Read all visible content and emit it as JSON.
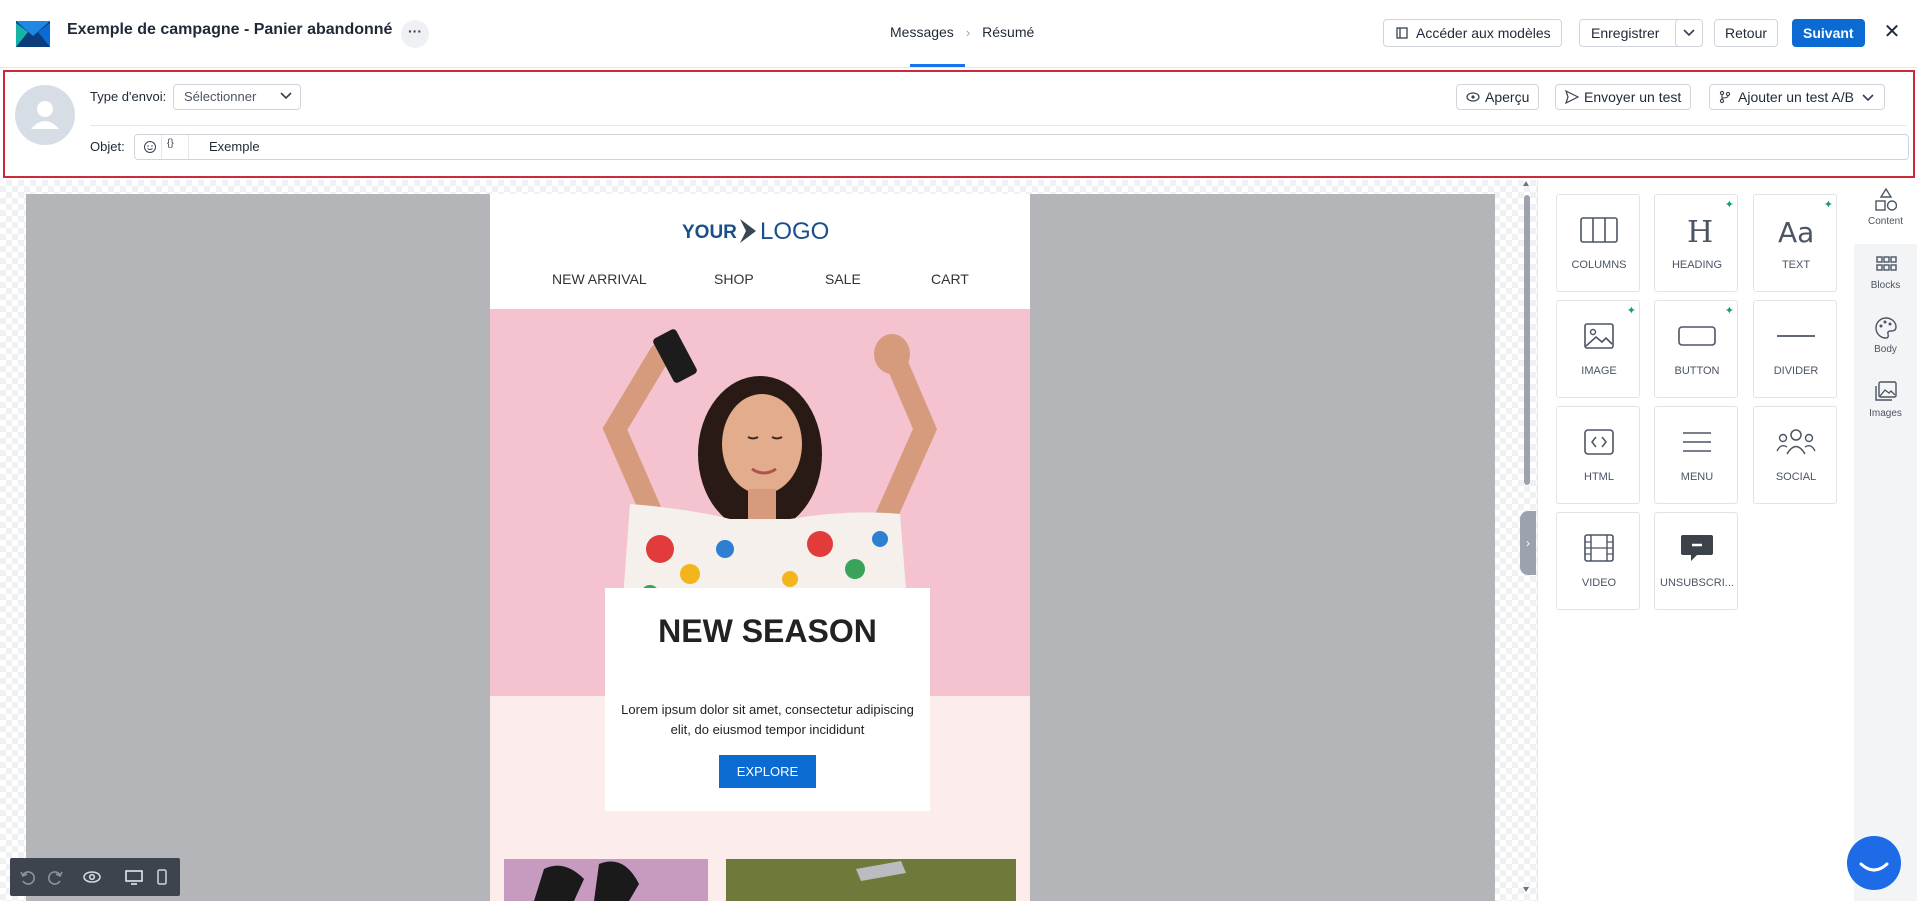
{
  "header": {
    "campaign_title": "Exemple de campagne - Panier abandonné",
    "more_label": "···",
    "steps": [
      "Messages",
      "Résumé"
    ],
    "step_separator": "›",
    "templates_label": "Accéder aux modèles",
    "save_label": "Enregistrer",
    "back_label": "Retour",
    "next_label": "Suivant",
    "close_label": "✕"
  },
  "settings": {
    "send_type_label": "Type d'envoi:",
    "send_type_value": "Sélectionner",
    "preview_label": "Aperçu",
    "send_test_label": "Envoyer un test",
    "ab_test_label": "Ajouter un test A/B",
    "subject_label": "Objet:",
    "subject_value": "Exemple",
    "personalize_label": "{}"
  },
  "email": {
    "logo_your": "YOUR",
    "logo_logo": "LOGO",
    "nav": [
      "NEW ARRIVAL",
      "SHOP",
      "SALE",
      "CART"
    ],
    "hero_title": "NEW SEASON",
    "hero_text": "Lorem ipsum dolor sit amet, consectetur adipiscing elit, do eiusmod tempor incididunt",
    "hero_button": "EXPLORE"
  },
  "content_tiles": [
    {
      "label": "COLUMNS",
      "icon": "columns-icon",
      "ai": false
    },
    {
      "label": "HEADING",
      "icon": "heading-icon",
      "ai": true
    },
    {
      "label": "TEXT",
      "icon": "text-icon",
      "ai": true
    },
    {
      "label": "IMAGE",
      "icon": "image-icon",
      "ai": true
    },
    {
      "label": "BUTTON",
      "icon": "button-icon",
      "ai": true
    },
    {
      "label": "DIVIDER",
      "icon": "divider-icon",
      "ai": false
    },
    {
      "label": "HTML",
      "icon": "html-icon",
      "ai": false
    },
    {
      "label": "MENU",
      "icon": "menu-icon",
      "ai": false
    },
    {
      "label": "SOCIAL",
      "icon": "social-icon",
      "ai": false
    },
    {
      "label": "VIDEO",
      "icon": "video-icon",
      "ai": false
    },
    {
      "label": "UNSUBSCRI...",
      "icon": "unsubscribe-icon",
      "ai": false
    }
  ],
  "rail": [
    {
      "label": "Content",
      "icon": "shapes-icon",
      "active": true
    },
    {
      "label": "Blocks",
      "icon": "grid-icon",
      "active": false
    },
    {
      "label": "Body",
      "icon": "palette-icon",
      "active": false
    },
    {
      "label": "Images",
      "icon": "images-icon",
      "active": false
    }
  ],
  "colors": {
    "primary": "#0b6bd3",
    "highlight_border": "#cc2a3b",
    "hero_pink": "#f4c3cf",
    "ai_spark": "#12a16e"
  }
}
